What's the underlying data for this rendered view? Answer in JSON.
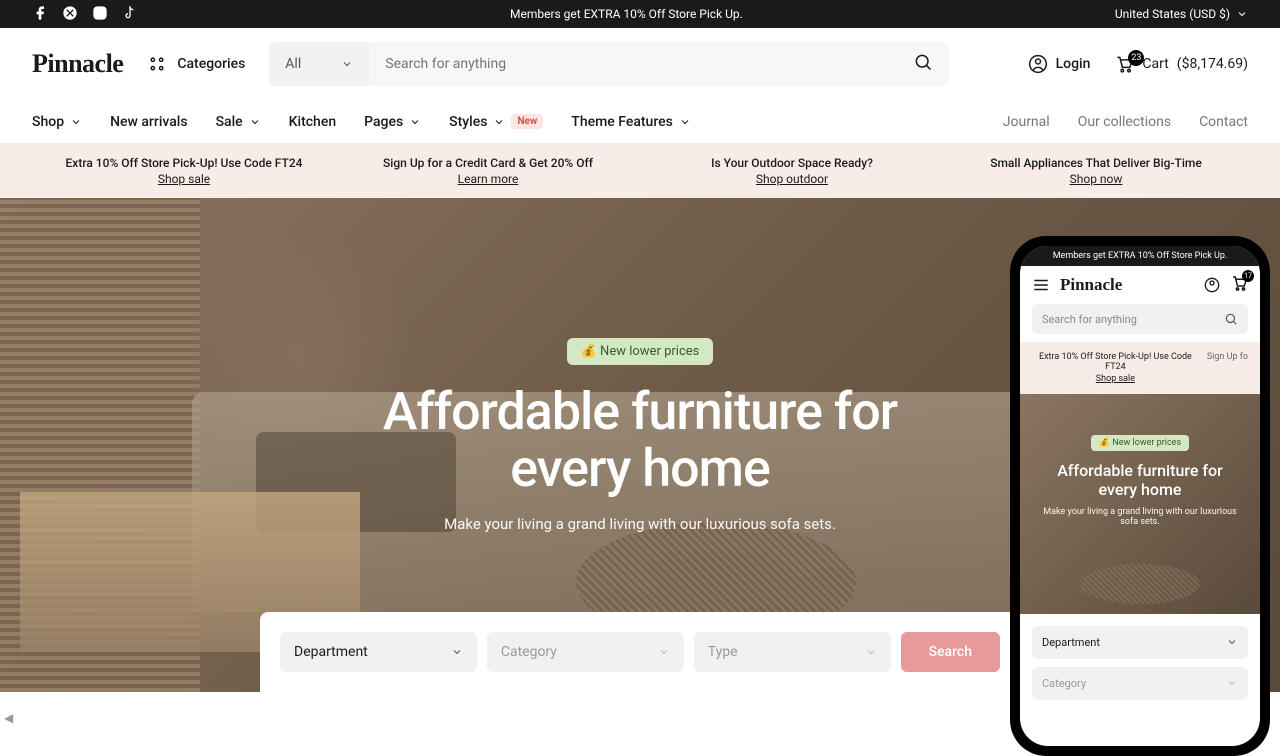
{
  "topbar": {
    "message": "Members get EXTRA 10% Off Store Pick Up.",
    "locale": "United States (USD $)"
  },
  "header": {
    "logo": "Pinnacle",
    "categories_label": "Categories",
    "search_select": "All",
    "search_placeholder": "Search for anything",
    "login": "Login",
    "cart_label": "Cart",
    "cart_badge": "23",
    "cart_total": "($8,174.69)"
  },
  "nav": {
    "left": [
      {
        "label": "Shop",
        "chevron": true
      },
      {
        "label": "New arrivals",
        "chevron": false
      },
      {
        "label": "Sale",
        "chevron": true
      },
      {
        "label": "Kitchen",
        "chevron": false
      },
      {
        "label": "Pages",
        "chevron": true
      },
      {
        "label": "Styles",
        "chevron": true,
        "badge": "New"
      },
      {
        "label": "Theme Features",
        "chevron": true
      }
    ],
    "right": [
      "Journal",
      "Our collections",
      "Contact"
    ]
  },
  "promos": [
    {
      "title": "Extra 10% Off Store Pick-Up! Use Code FT24",
      "link": "Shop sale"
    },
    {
      "title": "Sign Up for a Credit Card & Get 20% Off",
      "link": "Learn more"
    },
    {
      "title": "Is Your Outdoor Space Ready?",
      "link": "Shop outdoor"
    },
    {
      "title": "Small Appliances That Deliver Big-Time",
      "link": "Shop now"
    }
  ],
  "hero": {
    "pill": "💰 New lower prices",
    "title_l1": "Affordable furniture for",
    "title_l2": "every home",
    "subtitle": "Make your living a grand living with our luxurious sofa sets."
  },
  "finder": {
    "department": "Department",
    "category": "Category",
    "type": "Type",
    "search": "Search"
  },
  "phone": {
    "topbar": "Members get EXTRA 10% Off Store Pick Up.",
    "logo": "Pinnacle",
    "cart_badge": "17",
    "search_placeholder": "Search for anything",
    "promo_title": "Extra 10% Off Store Pick-Up! Use Code FT24",
    "promo_link": "Shop sale",
    "promo_side": "Sign Up fo",
    "pill": "💰 New lower prices",
    "hero_title": "Affordable furniture for every home",
    "hero_sub": "Make your living a grand living with our luxurious sofa sets.",
    "department": "Department",
    "category": "Category"
  }
}
